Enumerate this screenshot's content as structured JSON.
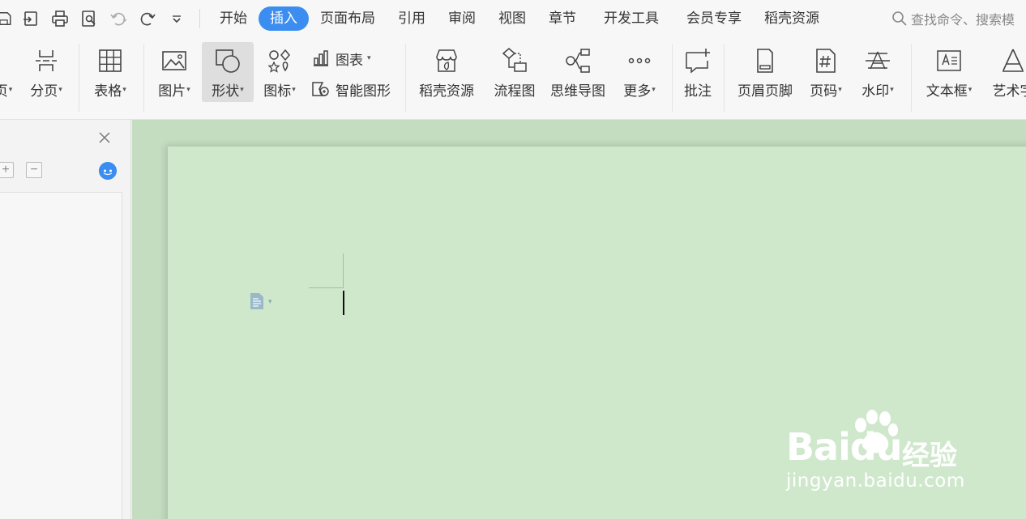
{
  "menubar": {
    "tabs": [
      {
        "label": "开始",
        "active": false
      },
      {
        "label": "插入",
        "active": true
      },
      {
        "label": "页面布局",
        "active": false
      },
      {
        "label": "引用",
        "active": false
      },
      {
        "label": "审阅",
        "active": false
      },
      {
        "label": "视图",
        "active": false
      },
      {
        "label": "章节",
        "active": false
      },
      {
        "label": "开发工具",
        "active": false
      },
      {
        "label": "会员专享",
        "active": false
      },
      {
        "label": "稻壳资源",
        "active": false
      }
    ],
    "search_text": "查找命令、搜索模"
  },
  "ribbon": {
    "items": {
      "page_label": "页",
      "page_break": "分页",
      "table": "表格",
      "picture": "图片",
      "shape": "形状",
      "icons": "图标",
      "chart": "图表",
      "smart_art": "智能图形",
      "docer": "稻壳资源",
      "flowchart": "流程图",
      "mindmap": "思维导图",
      "more": "更多",
      "comment": "批注",
      "header_footer": "页眉页脚",
      "page_number": "页码",
      "watermark": "水印",
      "textbox": "文本框",
      "wordart": "艺术字"
    }
  },
  "colors": {
    "accent": "#3b8ef0",
    "doc_bg": "#c4dcc0",
    "page_bg": "#cfe8cc"
  },
  "watermark": {
    "logo": "Baidu",
    "cn": "经验",
    "url": "jingyan.baidu.com"
  }
}
